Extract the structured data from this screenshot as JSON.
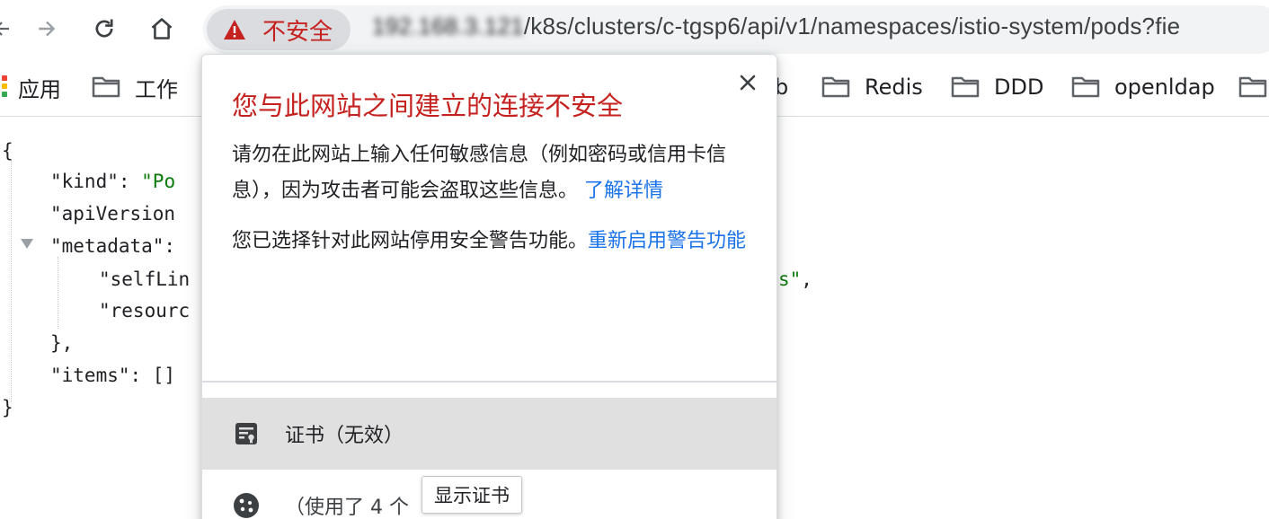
{
  "toolbar": {
    "security_chip_label": "不安全",
    "url_host": "192.168.3.121",
    "url_path": "/k8s/clusters/c-tgsp6/api/v1/namespaces/istio-system/pods?fie",
    "icons": [
      "back-arrow-icon",
      "forward-arrow-icon",
      "reload-icon",
      "home-icon",
      "warning-triangle-icon"
    ],
    "warning_color": "#c5221f"
  },
  "bookmarks": {
    "apps_label": "应用",
    "items": [
      {
        "label": "工作"
      },
      {
        "label": "b"
      },
      {
        "label": "Redis"
      },
      {
        "label": "DDD"
      },
      {
        "label": "openldap"
      },
      {
        "label": ""
      }
    ]
  },
  "json_view": {
    "open_brace": "{",
    "kind_key": "\"kind\": ",
    "kind_value": "\"Po",
    "api_version_key": "\"apiVersion",
    "metadata_key": "\"metadata\":",
    "self_link_key": "\"selfLin",
    "self_link_tail_value": "s\"",
    "self_link_tail_comma": ",",
    "resource_key": "\"resourc",
    "metadata_close": "},",
    "items_line": "\"items\": []",
    "close_brace": "}"
  },
  "popup": {
    "title": "您与此网站之间建立的连接不安全",
    "warning_text": "请勿在此网站上输入任何敏感信息（例如密码或信用卡信息），因为攻击者可能会盗取这些信息。",
    "learn_more_link": "了解详情",
    "disabled_text": "您已选择针对此网站停用安全警告功能。",
    "reenable_link": "重新启用警告功能",
    "certificate_label": "证书（无效）",
    "cookies_label": "（使用了 4 个",
    "close_icon": "close-icon",
    "title_color": "#c5221f",
    "link_color": "#1a73e8"
  },
  "tooltip": {
    "text": "显示证书"
  }
}
